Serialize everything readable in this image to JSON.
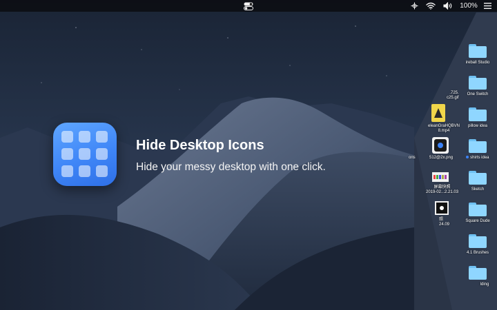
{
  "menubar": {
    "battery_label": "100%",
    "icons": [
      "toggle-switch-icon",
      "network-icon",
      "wifi-icon",
      "volume-icon",
      "menu-icon"
    ]
  },
  "promo": {
    "title": "Hide Desktop Icons",
    "subtitle": "Hide your messy desktop with one click.",
    "accent": "#3f86f7"
  },
  "desktop_icons": [
    {
      "label": "ireball Studio",
      "type": "folder"
    },
    {
      "label": "One Switch",
      "type": "folder"
    },
    {
      "label": "pillow idea",
      "type": "folder"
    },
    {
      "label": "shirts idea",
      "type": "folder",
      "tag_color": "#3b82f6"
    },
    {
      "label": "Sketch",
      "type": "folder"
    },
    {
      "label": "Square Dude",
      "type": "folder"
    },
    {
      "label": "4.1 Brushes",
      "type": "folder"
    },
    {
      "label": "lding",
      "type": "folder"
    }
  ],
  "file_icons": [
    {
      "line1": ".725.",
      "line2": "c25.gif"
    },
    {
      "line1": "eleanGraHQBVN",
      "line2": "8.mp4"
    },
    {
      "line1": "512@2x.png",
      "line2": ""
    },
    {
      "line1": "屏幕快照",
      "line2": "2019-02...2.21.03"
    },
    {
      "line1": "照",
      "line2": "24.09"
    }
  ],
  "fragments": {
    "left_label": "ons"
  }
}
